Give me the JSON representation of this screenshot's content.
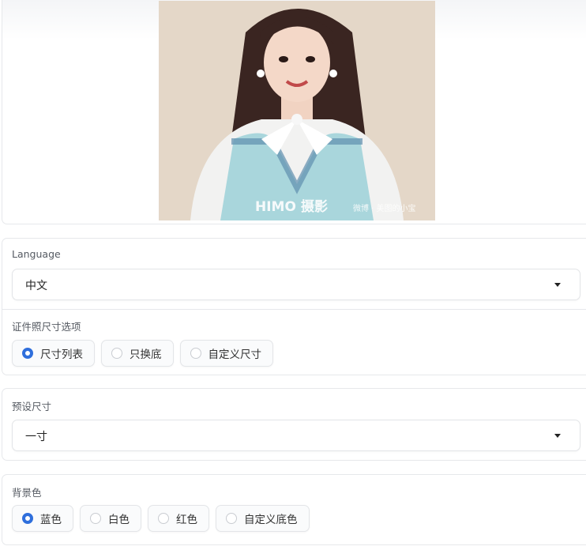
{
  "image": {
    "alt": "",
    "watermark_main": "HIMO",
    "watermark_cn": "摄影",
    "watermark_small": "微博 · 美图的小宝"
  },
  "language": {
    "label": "Language",
    "value": "中文"
  },
  "size_options": {
    "label": "证件照尺寸选项",
    "options": [
      "尺寸列表",
      "只换底",
      "自定义尺寸"
    ],
    "selected": 0
  },
  "preset_size": {
    "label": "预设尺寸",
    "value": "一寸"
  },
  "background": {
    "label": "背景色",
    "options": [
      "蓝色",
      "白色",
      "红色",
      "自定义底色"
    ],
    "selected": 0
  },
  "colors": {
    "accent": "#2f6fdc",
    "border": "#e6e8eb"
  }
}
